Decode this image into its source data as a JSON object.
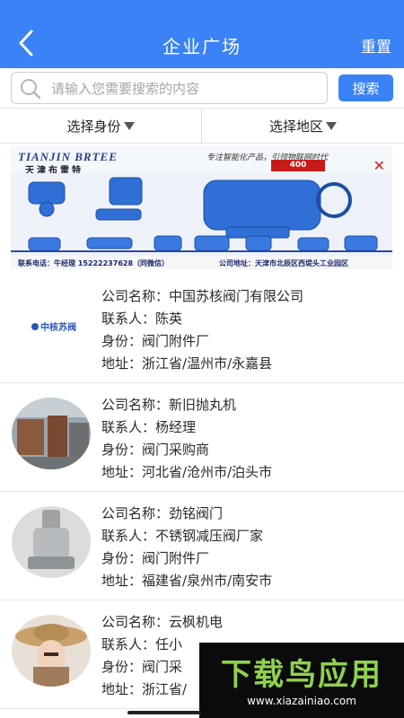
{
  "header": {
    "title": "企业广场",
    "reset_label": "重置",
    "back_icon": "chevron-left-icon",
    "background": "#3b82f6"
  },
  "search": {
    "placeholder": "请输入您需要搜索的内容",
    "value": "",
    "button_label": "搜索",
    "icon": "search-icon"
  },
  "filters": {
    "identity_label": "选择身份",
    "region_label": "选择地区"
  },
  "banner": {
    "brand": "TIANJIN BRTEE",
    "brand_cn": "天津布雷特",
    "slogan": "专注智能化产品，引领物联网时代",
    "badge": "400",
    "contact": "联系电话：牛经理 15222237628（同微信）",
    "address": "公司地址：天津市北辰区西堤头工业园区",
    "close_icon": "close-icon"
  },
  "labels": {
    "company": "公司名称：",
    "contact": "联系人：",
    "identity": "身份：",
    "address": "地址："
  },
  "companies": [
    {
      "company": "中国苏核阀门有限公司",
      "contact": "陈英",
      "identity": "阀门附件厂",
      "address": "浙江省/温州市/永嘉县",
      "avatar": "suhe-logo-avatar"
    },
    {
      "company": "新旧抛丸机",
      "contact": "杨经理",
      "identity": "阀门采购商",
      "address": "河北省/沧州市/泊头市",
      "avatar": "machine-photo-avatar"
    },
    {
      "company": "劲铭阀门",
      "contact": "不锈钢减压阀厂家",
      "identity": "阀门附件厂",
      "address": "福建省/泉州市/南安市",
      "avatar": "valve-photo-avatar"
    },
    {
      "company": "云枫机电",
      "contact": "任小",
      "identity": "阀门采",
      "address": "浙江省/",
      "avatar": "person-photo-avatar"
    }
  ],
  "watermark": {
    "logo": "下载鸟应用",
    "url": "www.xiazainiao.com"
  }
}
